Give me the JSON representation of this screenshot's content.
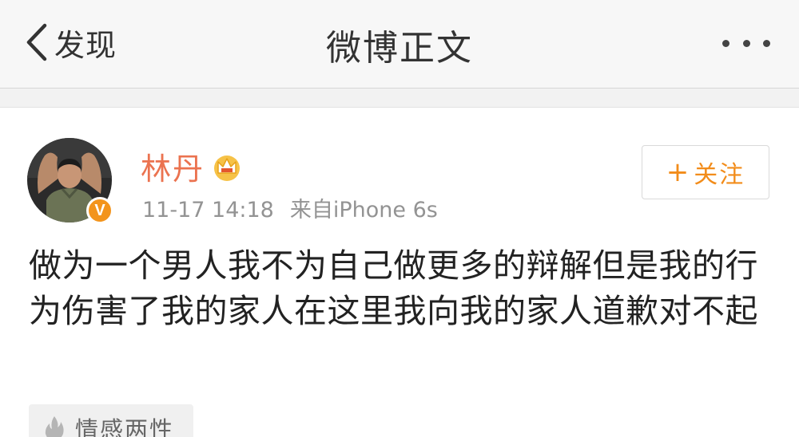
{
  "navbar": {
    "back_label": "发现",
    "title": "微博正文",
    "icons": {
      "back": "chevron-left-icon",
      "more": "more-dots-icon"
    }
  },
  "post": {
    "author": {
      "name": "林丹",
      "verified_badge": "V",
      "badges": [
        "verified-v-icon",
        "crown-icon"
      ]
    },
    "time": "11-17 14:18",
    "source": "来自iPhone 6s",
    "follow_button": {
      "icon": "+",
      "label": "关注"
    },
    "text": "做为一个男人我不为自己做更多的辩解但是我的行为伤害了我的家人在这里我向我的家人道歉对不起",
    "topic": {
      "label": "情感两性",
      "icon": "flame-icon"
    }
  },
  "colors": {
    "username": "#eb7350",
    "accent_orange": "#f28c1a",
    "meta_gray": "#939393",
    "body_text": "#222222",
    "navbar_bg": "#f7f7f7",
    "page_bg": "#f2f2f2"
  }
}
